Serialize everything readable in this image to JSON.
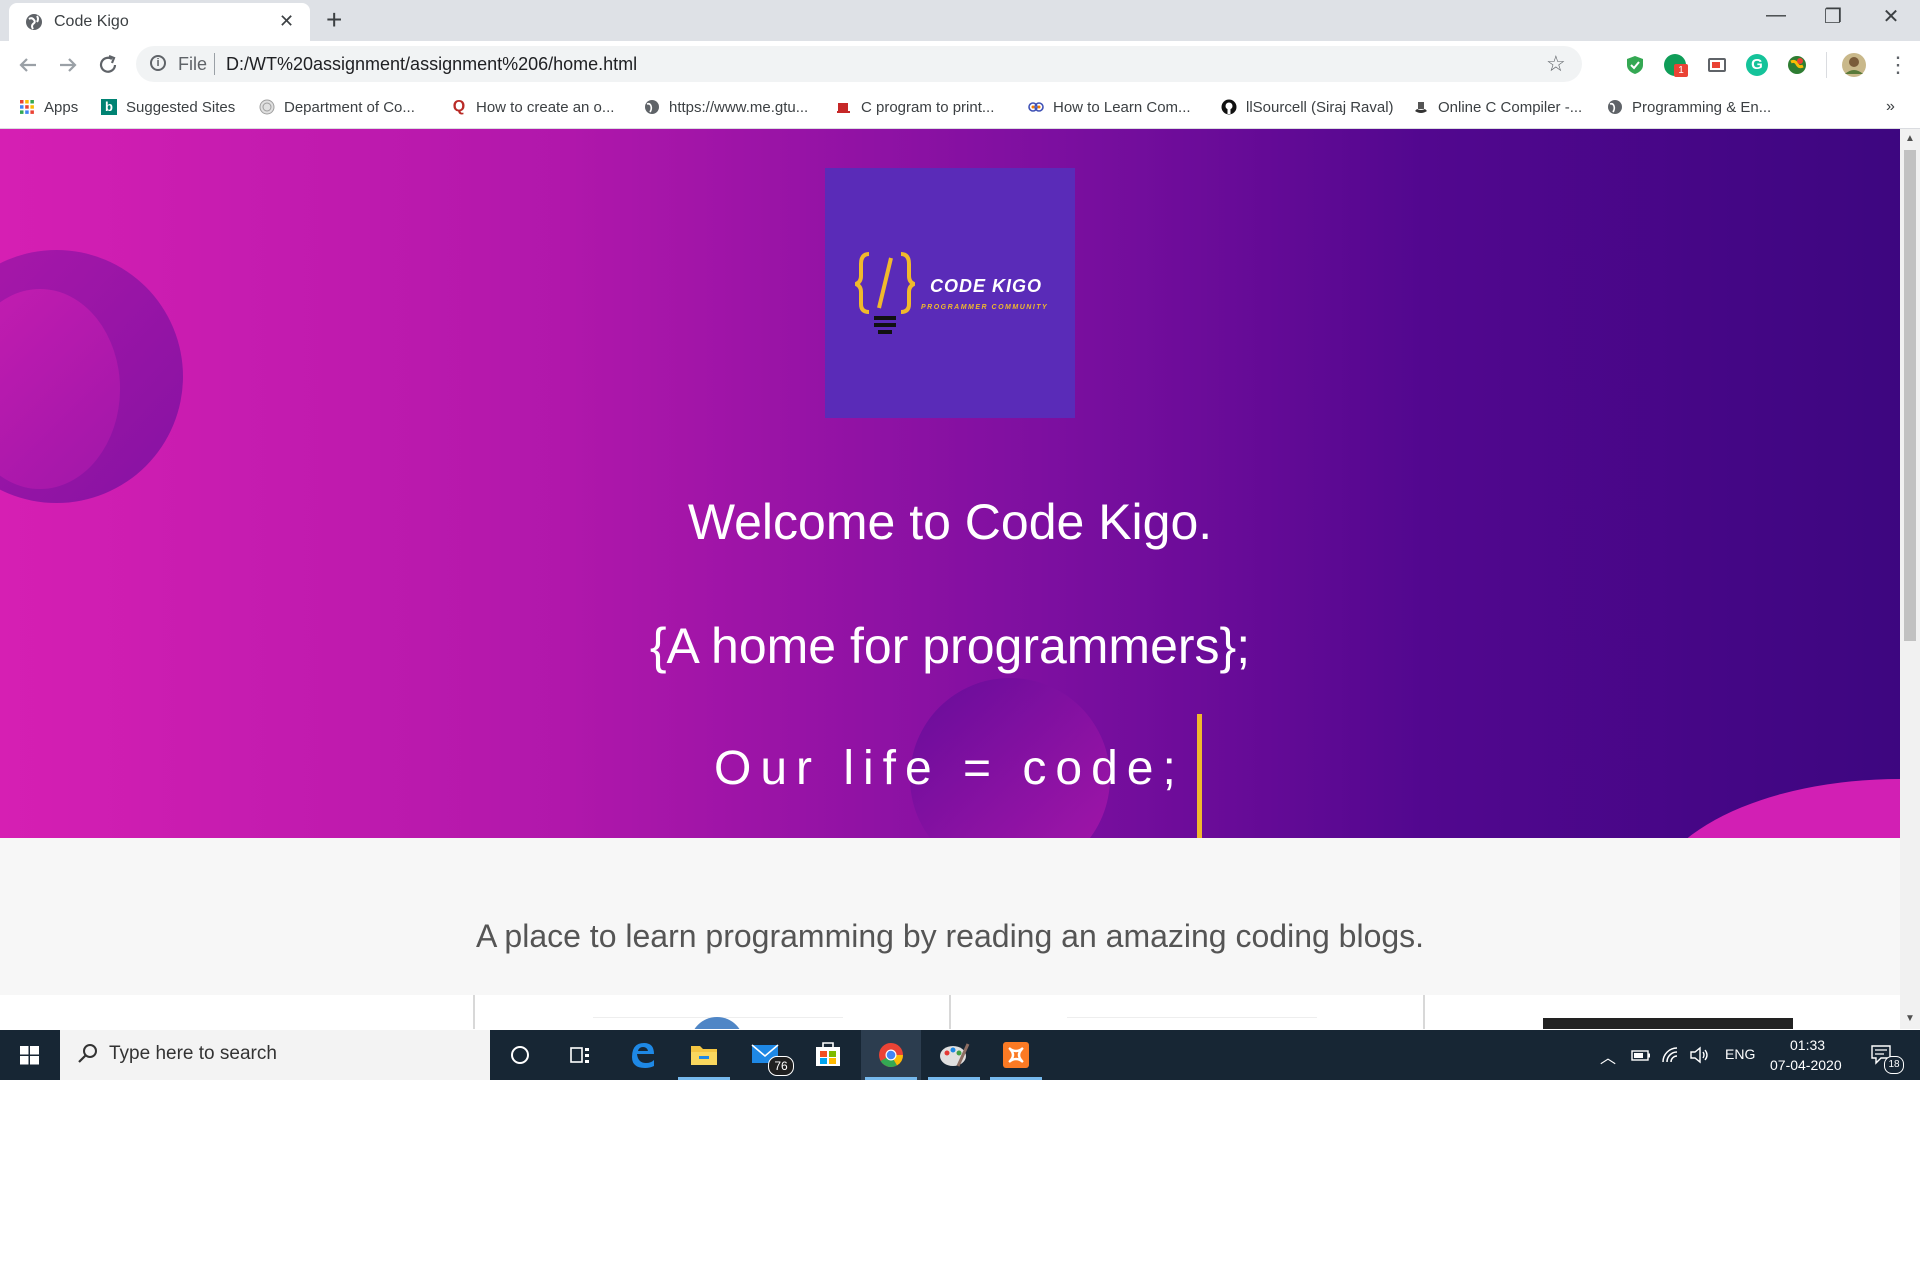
{
  "browser": {
    "tab_title": "Code Kigo",
    "new_tab_symbol": "+",
    "close_symbol": "✕",
    "window_controls": {
      "minimize": "—",
      "restore": "❐",
      "close": "✕"
    },
    "url_scheme_label": "File",
    "url": "D:/WT%20assignment/assignment%206/home.html",
    "extension_badge": "1"
  },
  "bookmarks": [
    {
      "label": "Apps",
      "icon": "apps-grid-icon"
    },
    {
      "label": "Suggested Sites",
      "icon": "bing-icon"
    },
    {
      "label": "Department of Co...",
      "icon": "seal-icon"
    },
    {
      "label": "How to create an o...",
      "icon": "quora-icon"
    },
    {
      "label": "https://www.me.gtu...",
      "icon": "globe-icon"
    },
    {
      "label": "C program to print...",
      "icon": "cup-icon"
    },
    {
      "label": "How to Learn Com...",
      "icon": "owl-icon"
    },
    {
      "label": "llSourcell (Siraj Raval)",
      "icon": "github-icon"
    },
    {
      "label": "Online C Compiler -...",
      "icon": "compiler-icon"
    },
    {
      "label": "Programming & En...",
      "icon": "globe-icon"
    }
  ],
  "bookmarks_overflow": "»",
  "page": {
    "logo_name": "CODE KIGO",
    "logo_subtitle": "PROGRAMMER COMMUNITY",
    "hero_title": "Welcome to Code Kigo.",
    "hero_subtitle": "{A home for programmers};",
    "hero_typed": "Our life = code;",
    "tagline": "A place to learn programming by reading an amazing coding blogs."
  },
  "taskbar": {
    "search_placeholder": "Type here to search",
    "mail_badge": "76",
    "language": "ENG",
    "time": "01:33",
    "date": "07-04-2020",
    "notification_count": "18"
  },
  "colors": {
    "hero_start": "#d61fb3",
    "hero_end": "#3d0680",
    "logo_bg": "#5a2bb8",
    "accent_gold": "#f0b92c",
    "taskbar": "#172634"
  }
}
